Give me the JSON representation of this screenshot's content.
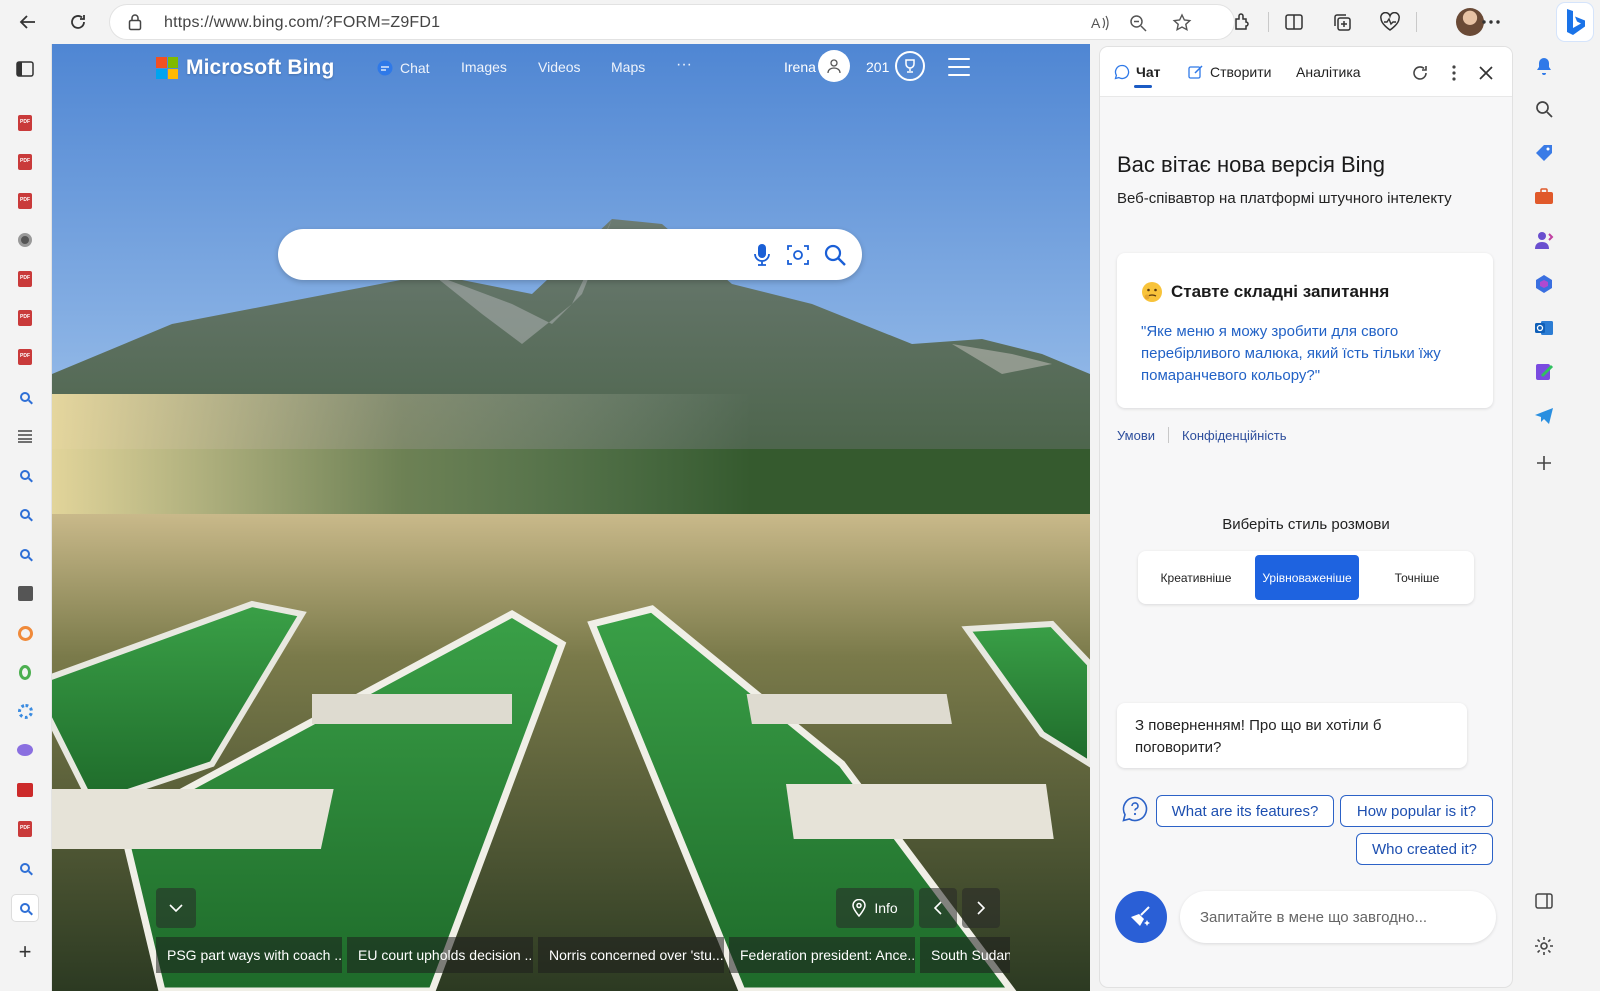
{
  "browser": {
    "url": "https://www.bing.com/?FORM=Z9FD1",
    "icons": [
      "back-icon",
      "refresh-icon",
      "lock-icon",
      "read-aloud-icon",
      "zoom-out-icon",
      "favorite-star-icon",
      "extensions-icon",
      "split-screen-icon",
      "collections-icon",
      "health-icon",
      "profile-avatar",
      "more-icon",
      "bing-copilot-icon"
    ]
  },
  "vertical_tabs": {
    "add_label": "+"
  },
  "bing": {
    "logo_text": "Microsoft Bing",
    "nav": {
      "chat": "Chat",
      "images": "Images",
      "videos": "Videos",
      "maps": "Maps",
      "more": "···"
    },
    "user_name": "Irena",
    "points": "201",
    "search_placeholder": "",
    "info_label": "Info",
    "news": [
      "PSG part ways with coach ...",
      "EU court upholds decision ...",
      "Norris concerned over 'stu...",
      "Federation president: Ance...",
      "South Sudan"
    ]
  },
  "copilot": {
    "tabs": {
      "chat": "Чат",
      "create": "Створити",
      "analytics": "Аналітика"
    },
    "welcome_title": "Вас вітає нова версія Bing",
    "welcome_subtitle": "Веб-співавтор на платформі штучного інтелекту",
    "card_title": "Ставте складні запитання",
    "card_quote": "\"Яке меню я можу зробити для свого перебірливого малюка, який їсть тільки їжу помаранчевого кольору?\"",
    "terms": "Умови",
    "privacy": "Конфіденційність",
    "style_title": "Виберіть стиль розмови",
    "styles": {
      "creative": "Креативніше",
      "balanced": "Урівноваженіше",
      "precise": "Точніше"
    },
    "selected_style": "Урівноваженіше",
    "greeting": "З поверненням! Про що ви хотіли б поговорити?",
    "suggestions": [
      "What are its features?",
      "How popular is it?",
      "Who created it?"
    ],
    "ask_placeholder": "Запитайте в мене що завгодно..."
  },
  "colors": {
    "accent": "#1e63e0",
    "link": "#2262c6",
    "sky_top": "#5b8fd6",
    "water": "#5a6a3c"
  }
}
